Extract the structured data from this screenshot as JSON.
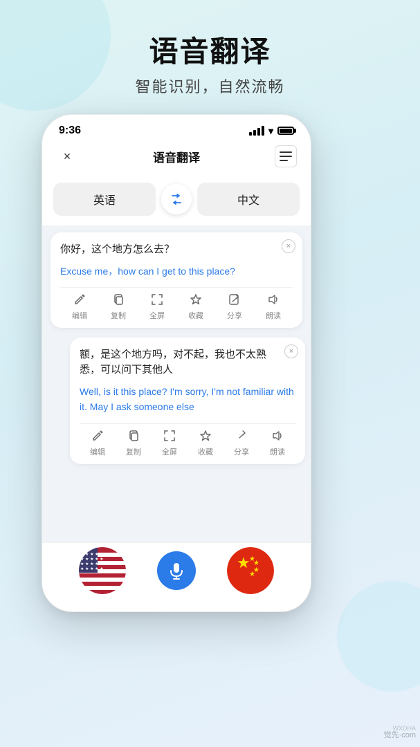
{
  "page": {
    "bg_gradient_start": "#e0f4f4",
    "bg_gradient_end": "#e8f0fb"
  },
  "header": {
    "title": "语音翻译",
    "subtitle": "智能识别，自然流畅"
  },
  "phone": {
    "status_bar": {
      "time": "9:36"
    },
    "app_header": {
      "title": "语音翻译",
      "close_label": "×"
    },
    "lang_selector": {
      "source_lang": "英语",
      "target_lang": "中文",
      "swap_symbol": "⇌"
    },
    "cards": [
      {
        "id": "card-1",
        "original": "你好，这个地方怎么去？",
        "translated": "Excuse me，how can I get to this place?",
        "actions": [
          "编辑",
          "复制",
          "全屏",
          "收藏",
          "分享",
          "朗读"
        ]
      },
      {
        "id": "card-2",
        "original": "额，是这个地方吗，对不起，我也不太熟悉，可以问下其他人",
        "translated": "Well, is it this place? I'm sorry, I'm not familiar with it. May I ask someone else",
        "actions": [
          "编辑",
          "复制",
          "全屏",
          "收藏",
          "分享",
          "朗读"
        ]
      }
    ],
    "bottom_bar": {
      "flag_left": "🇺🇸",
      "flag_right": "🇨🇳",
      "mic_icon": "🎤"
    }
  },
  "watermark": {
    "top": "WXDHA",
    "bottom": "觉先·com"
  },
  "icons": {
    "edit": "✏",
    "copy": "⧉",
    "fullscreen": "⤢",
    "star": "☆",
    "share": "↗",
    "sound": "🔊",
    "close": "×",
    "menu": "☰"
  }
}
